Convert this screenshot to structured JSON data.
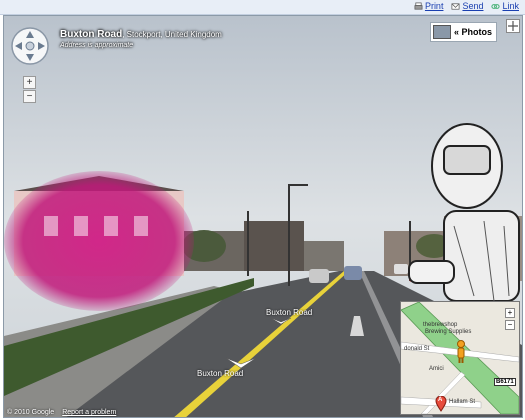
{
  "toolbar": {
    "print_label": "Print",
    "send_label": "Send",
    "link_label": "Link"
  },
  "address": {
    "road": "Buxton Road",
    "location": ", Stockport, United Kingdom",
    "note": "Address is approximate"
  },
  "photos_button": {
    "label": "« Photos"
  },
  "zoom": {
    "in": "+",
    "out": "−"
  },
  "road_labels": {
    "upper": "Buxton Road",
    "lower": "Buxton Road"
  },
  "footer": {
    "copyright": "© 2010 Google",
    "report": "Report a problem"
  },
  "minimap": {
    "labels": {
      "shop_line1": "thebrewshop",
      "shop_line2": "Brewing Supplies",
      "street_donald": "donald St",
      "amici": "Amici",
      "route": "B6171",
      "street_hallam": "Hallam St"
    },
    "zoom_in": "+",
    "zoom_out": "−",
    "marker_letter": "A"
  },
  "colors": {
    "toolbar_bg": "#e8eef7",
    "link_blue": "#1a3fb0",
    "blur_magenta": "#c0187a",
    "road_green": "#8fd18a"
  }
}
